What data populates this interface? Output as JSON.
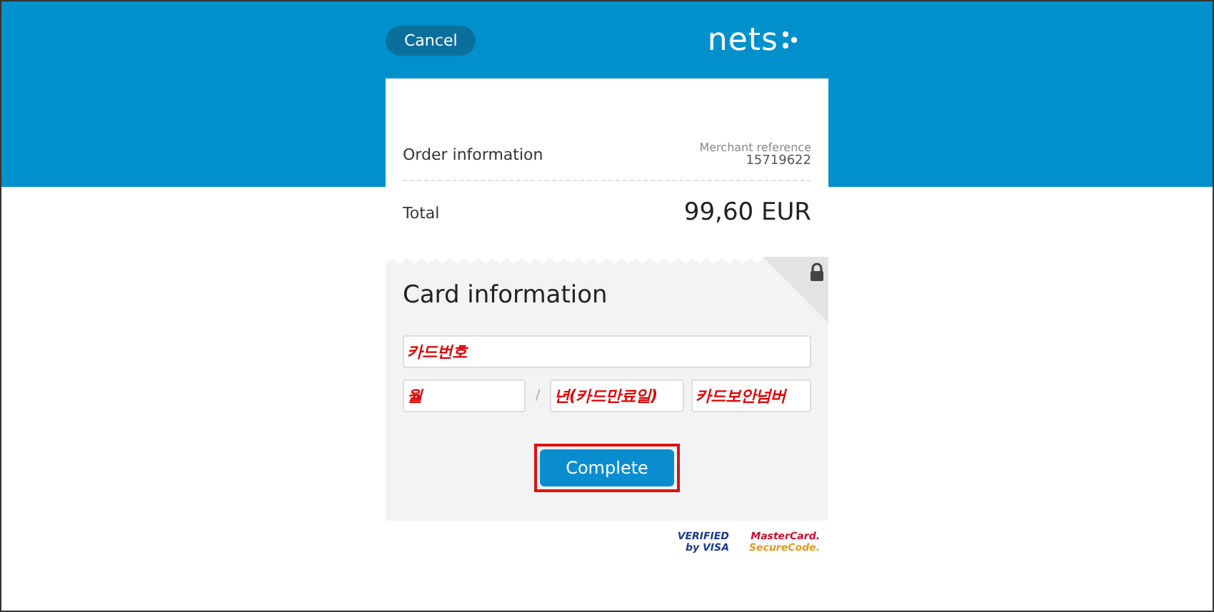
{
  "header": {
    "cancel_button": "Cancel",
    "logo": "nets"
  },
  "order": {
    "label": "Order information",
    "merchant_label": "Merchant reference",
    "merchant_reference": "15719622",
    "total_label": "Total",
    "total": "99,60 EUR"
  },
  "card": {
    "title": "Card information",
    "locked": true,
    "fields": [
      {
        "kind": "wide",
        "annotation": "카드번호"
      },
      {
        "kind": "month",
        "annotation": "월"
      },
      {
        "kind": "separator",
        "text": "/"
      },
      {
        "kind": "year",
        "annotation": "년(카드만료일)"
      },
      {
        "kind": "cvc",
        "annotation": "카드보안넘버"
      }
    ],
    "submit_button": "Complete",
    "submit_highlighted": true
  },
  "badges": [
    {
      "line1": "VERIFIED",
      "line2": "by VISA",
      "kind": "visa"
    },
    {
      "line1": "MasterCard.",
      "line2": "SecureCode.",
      "kind": "mastercard"
    }
  ]
}
